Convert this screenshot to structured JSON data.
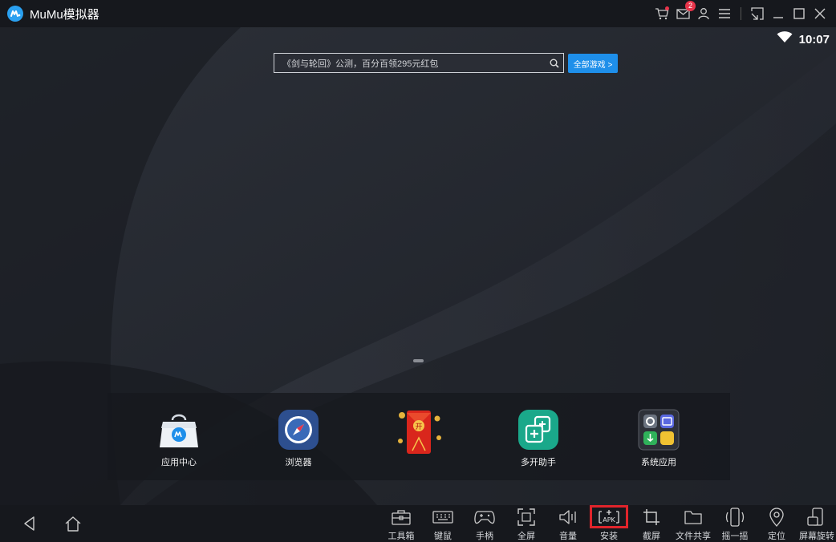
{
  "window": {
    "title": "MuMu模拟器",
    "mail_badge": "2"
  },
  "statusbar": {
    "time": "10:07"
  },
  "search": {
    "text": "《剑与轮回》公测，百分百领295元红包",
    "all_games_label": "全部游戏 >"
  },
  "dock": {
    "items": [
      {
        "label": "应用中心",
        "icon": "app-center-icon"
      },
      {
        "label": "浏览器",
        "icon": "browser-compass-icon"
      },
      {
        "label": "",
        "icon": "red-envelope-icon",
        "envelope_char": "开"
      },
      {
        "label": "多开助手",
        "icon": "multi-instance-icon"
      },
      {
        "label": "系统应用",
        "icon": "system-apps-folder-icon"
      }
    ]
  },
  "toolbar": {
    "items": [
      {
        "label": "工具箱",
        "icon": "toolbox-icon"
      },
      {
        "label": "键鼠",
        "icon": "keyboard-icon"
      },
      {
        "label": "手柄",
        "icon": "gamepad-icon"
      },
      {
        "label": "全屏",
        "icon": "fullscreen-icon"
      },
      {
        "label": "音量",
        "icon": "volume-icon"
      },
      {
        "label": "安装",
        "icon": "apk-install-icon",
        "icon_text": "APK"
      },
      {
        "label": "截屏",
        "icon": "crop-icon"
      },
      {
        "label": "文件共享",
        "icon": "folder-icon"
      },
      {
        "label": "摇一摇",
        "icon": "shake-icon"
      },
      {
        "label": "定位",
        "icon": "location-pin-icon"
      },
      {
        "label": "屏幕旋转",
        "icon": "rotate-screen-icon"
      }
    ]
  },
  "colors": {
    "accent": "#1e8fea",
    "highlight": "#e0242b",
    "badge": "#e8344a"
  }
}
